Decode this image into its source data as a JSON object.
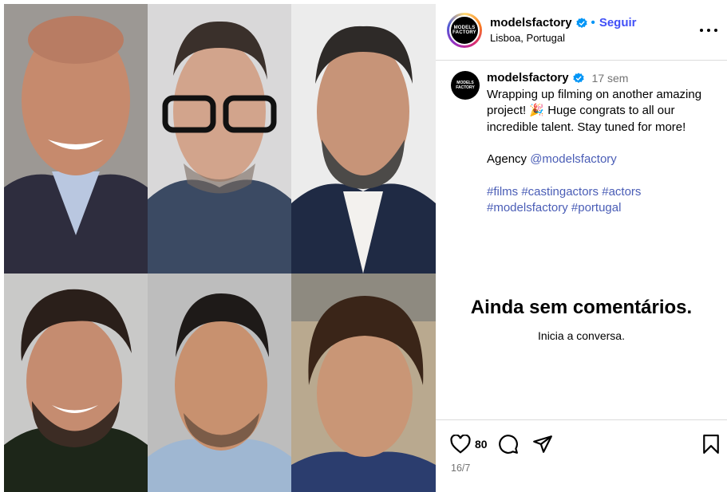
{
  "post": {
    "username": "modelsfactory",
    "follow_label": "Seguir",
    "dot": "•",
    "location": "Lisboa, Portugal",
    "avatar_text": [
      "MODELS",
      "FACTORY"
    ]
  },
  "caption": {
    "username": "modelsfactory",
    "time": "17 sem",
    "line1": "Wrapping up filming on another amazing project! 🎉 Huge congrats to all our incredible talent. Stay tuned for more!",
    "agency_label": "Agency ",
    "agency_mention": "@modelsfactory",
    "hashtags_line1": "#films #castingactors #actors",
    "hashtags_line2": "#modelsfactory #portugal"
  },
  "comments": {
    "empty_title": "Ainda sem comentários.",
    "empty_sub": "Inicia a conversa."
  },
  "actions": {
    "likes": "80",
    "date": "16/7"
  },
  "icons": [
    "verified-badge-icon",
    "more-options-icon",
    "heart-icon",
    "comment-icon",
    "share-icon",
    "bookmark-icon"
  ],
  "colors": {
    "accent": "#4150f7",
    "verified": "#0095f6",
    "muted": "#737373",
    "divider": "#dbdbdb"
  }
}
